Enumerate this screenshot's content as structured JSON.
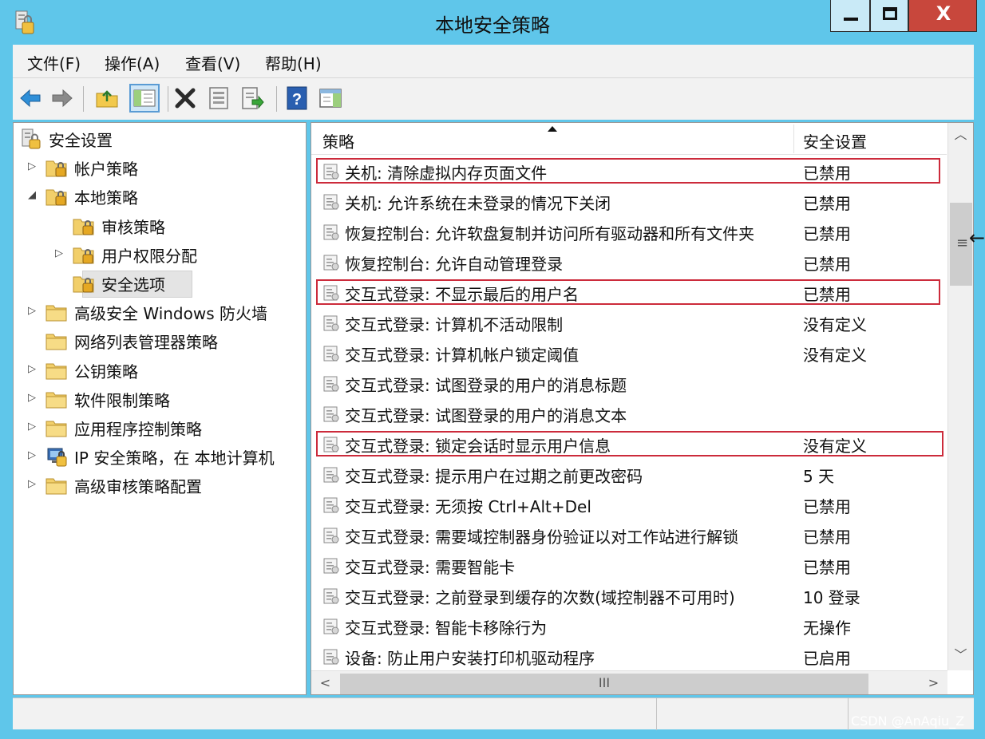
{
  "window": {
    "title": "本地安全策略",
    "controls": {
      "minimize": "minimize",
      "maximize": "maximize",
      "close_glyph": "X"
    }
  },
  "menu": [
    {
      "label": "文件(F)"
    },
    {
      "label": "操作(A)"
    },
    {
      "label": "查看(V)"
    },
    {
      "label": "帮助(H)"
    }
  ],
  "toolbar": {
    "icons": [
      "back-arrow-icon",
      "forward-arrow-icon",
      "up-folder-icon",
      "show-hide-tree-icon",
      "delete-icon",
      "properties-icon",
      "export-list-icon",
      "help-icon",
      "show-hide-action-pane-icon"
    ]
  },
  "tree": [
    {
      "label": "安全设置",
      "expander": "",
      "icon": "security-settings-icon",
      "level": 0,
      "selected": false
    },
    {
      "label": "帐户策略",
      "expander": "▷",
      "icon": "folder-lock-icon",
      "level": 1,
      "selected": false
    },
    {
      "label": "本地策略",
      "expander": "◢",
      "icon": "folder-lock-icon",
      "level": 1,
      "selected": false
    },
    {
      "label": "审核策略",
      "expander": "",
      "icon": "folder-lock-icon",
      "level": 2,
      "selected": false
    },
    {
      "label": "用户权限分配",
      "expander": "▷",
      "icon": "folder-lock-icon",
      "level": 2,
      "selected": false
    },
    {
      "label": "安全选项",
      "expander": "",
      "icon": "folder-lock-icon",
      "level": 2,
      "selected": true
    },
    {
      "label": "高级安全 Windows 防火墙",
      "expander": "▷",
      "icon": "folder-icon",
      "level": 1,
      "selected": false
    },
    {
      "label": "网络列表管理器策略",
      "expander": "",
      "icon": "folder-icon",
      "level": 1,
      "selected": false
    },
    {
      "label": "公钥策略",
      "expander": "▷",
      "icon": "folder-icon",
      "level": 1,
      "selected": false
    },
    {
      "label": "软件限制策略",
      "expander": "▷",
      "icon": "folder-icon",
      "level": 1,
      "selected": false
    },
    {
      "label": "应用程序控制策略",
      "expander": "▷",
      "icon": "folder-icon",
      "level": 1,
      "selected": false
    },
    {
      "label": "IP 安全策略，在 本地计算机",
      "expander": "▷",
      "icon": "ip-security-icon",
      "level": 1,
      "selected": false
    },
    {
      "label": "高级审核策略配置",
      "expander": "▷",
      "icon": "folder-icon",
      "level": 1,
      "selected": false
    }
  ],
  "list": {
    "columns": [
      "策略",
      "安全设置"
    ],
    "rows": [
      {
        "name": "关机: 清除虚拟内存页面文件",
        "value": "已禁用",
        "highlighted": true
      },
      {
        "name": "关机: 允许系统在未登录的情况下关闭",
        "value": "已禁用",
        "highlighted": false
      },
      {
        "name": "恢复控制台: 允许软盘复制并访问所有驱动器和所有文件夹",
        "value": "已禁用",
        "highlighted": false
      },
      {
        "name": "恢复控制台: 允许自动管理登录",
        "value": "已禁用",
        "highlighted": false
      },
      {
        "name": "交互式登录: 不显示最后的用户名",
        "value": "已禁用",
        "highlighted": true
      },
      {
        "name": "交互式登录: 计算机不活动限制",
        "value": "没有定义",
        "highlighted": false
      },
      {
        "name": "交互式登录: 计算机帐户锁定阈值",
        "value": "没有定义",
        "highlighted": false
      },
      {
        "name": "交互式登录: 试图登录的用户的消息标题",
        "value": "",
        "highlighted": false
      },
      {
        "name": "交互式登录: 试图登录的用户的消息文本",
        "value": "",
        "highlighted": false
      },
      {
        "name": "交互式登录: 锁定会话时显示用户信息",
        "value": "没有定义",
        "highlighted": true
      },
      {
        "name": "交互式登录: 提示用户在过期之前更改密码",
        "value": "5 天",
        "highlighted": false
      },
      {
        "name": "交互式登录: 无须按 Ctrl+Alt+Del",
        "value": "已禁用",
        "highlighted": false
      },
      {
        "name": "交互式登录: 需要域控制器身份验证以对工作站进行解锁",
        "value": "已禁用",
        "highlighted": false
      },
      {
        "name": "交互式登录: 需要智能卡",
        "value": "已禁用",
        "highlighted": false
      },
      {
        "name": "交互式登录: 之前登录到缓存的次数(域控制器不可用时)",
        "value": "10 登录",
        "highlighted": false
      },
      {
        "name": "交互式登录: 智能卡移除行为",
        "value": "无操作",
        "highlighted": false
      },
      {
        "name": "设备: 防止用户安装打印机驱动程序",
        "value": "已启用",
        "highlighted": false
      }
    ]
  },
  "scrollbars": {
    "vertical": {
      "up": "︿",
      "down": "﹀",
      "grip": "≡"
    },
    "horizontal": {
      "left": "<",
      "right": ">",
      "grip": "III"
    }
  },
  "edge_arrow": "←",
  "watermark": "CSDN @AnAqiu_Z",
  "colors": {
    "window_frame": "#5fc6ea",
    "close_button": "#c8473c",
    "highlight_border": "#cc2b3b",
    "selection": "#e4e4e4"
  }
}
